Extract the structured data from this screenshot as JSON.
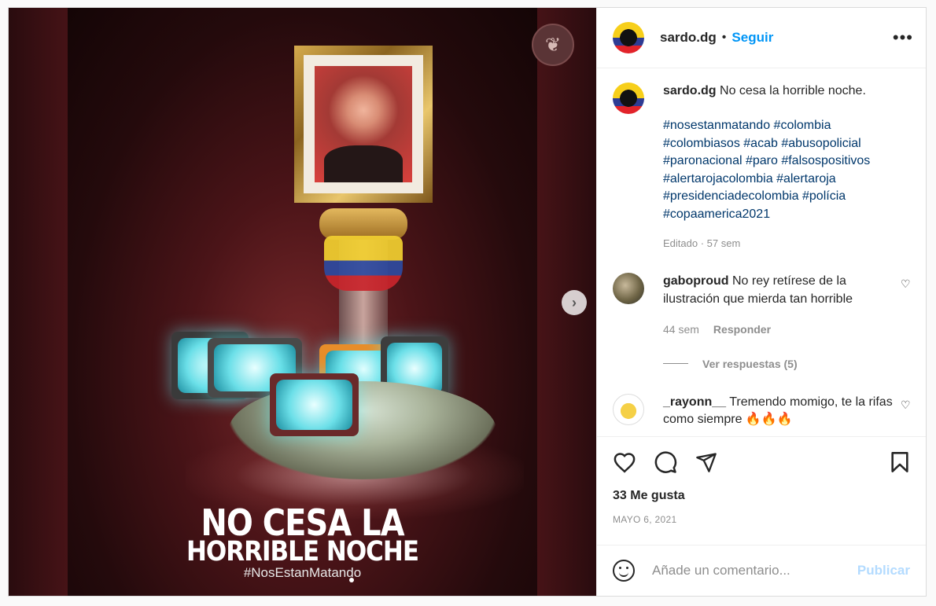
{
  "post": {
    "username": "sardo.dg",
    "separator": "•",
    "follow_label": "Seguir",
    "more_label": "•••",
    "poster": {
      "title_line1": "NO CESA LA",
      "title_line2": "HORRIBLE NOCHE",
      "hashtag": "#NosEstanMatando",
      "next_icon": "›"
    }
  },
  "caption": {
    "username": "sardo.dg",
    "text": "No cesa la horrible noche.",
    "hashtags": [
      "#nosestanmatando #colombia",
      "#colombiasos #acab #abusopolicial",
      "#paronacional #paro #falsospositivos",
      "#alertarojacolombia #alertaroja",
      "#presidenciadecolombia #polícia",
      "#copaamerica2021"
    ],
    "meta": "Editado · 57 sem"
  },
  "comments": [
    {
      "username": "gaboproud",
      "text": "No rey retírese de la ilustración que mierda tan horrible",
      "time": "44 sem",
      "reply_label": "Responder",
      "view_replies": "Ver respuestas (5)"
    },
    {
      "username": "_rayonn__",
      "text": "Tremendo momigo, te la rifas como siempre 🔥🔥🔥"
    }
  ],
  "actions": {
    "likes": "33 Me gusta",
    "date": "MAYO 6, 2021"
  },
  "add_comment": {
    "placeholder": "Añade un comentario...",
    "post_label": "Publicar"
  }
}
